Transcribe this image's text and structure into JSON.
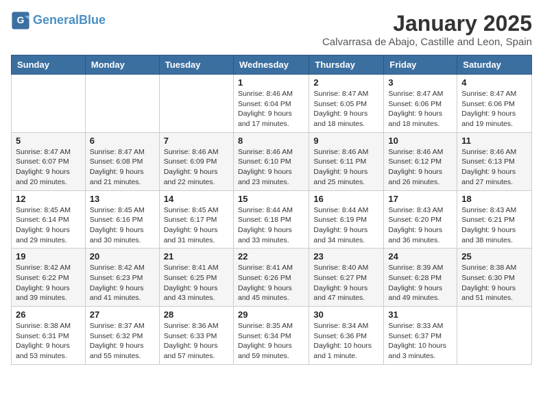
{
  "logo": {
    "line1": "General",
    "line2": "Blue"
  },
  "title": "January 2025",
  "subtitle": "Calvarrasa de Abajo, Castille and Leon, Spain",
  "days_of_week": [
    "Sunday",
    "Monday",
    "Tuesday",
    "Wednesday",
    "Thursday",
    "Friday",
    "Saturday"
  ],
  "weeks": [
    [
      {
        "day": "",
        "info": ""
      },
      {
        "day": "",
        "info": ""
      },
      {
        "day": "",
        "info": ""
      },
      {
        "day": "1",
        "info": "Sunrise: 8:46 AM\nSunset: 6:04 PM\nDaylight: 9 hours and 17 minutes."
      },
      {
        "day": "2",
        "info": "Sunrise: 8:47 AM\nSunset: 6:05 PM\nDaylight: 9 hours and 18 minutes."
      },
      {
        "day": "3",
        "info": "Sunrise: 8:47 AM\nSunset: 6:06 PM\nDaylight: 9 hours and 18 minutes."
      },
      {
        "day": "4",
        "info": "Sunrise: 8:47 AM\nSunset: 6:06 PM\nDaylight: 9 hours and 19 minutes."
      }
    ],
    [
      {
        "day": "5",
        "info": "Sunrise: 8:47 AM\nSunset: 6:07 PM\nDaylight: 9 hours and 20 minutes."
      },
      {
        "day": "6",
        "info": "Sunrise: 8:47 AM\nSunset: 6:08 PM\nDaylight: 9 hours and 21 minutes."
      },
      {
        "day": "7",
        "info": "Sunrise: 8:46 AM\nSunset: 6:09 PM\nDaylight: 9 hours and 22 minutes."
      },
      {
        "day": "8",
        "info": "Sunrise: 8:46 AM\nSunset: 6:10 PM\nDaylight: 9 hours and 23 minutes."
      },
      {
        "day": "9",
        "info": "Sunrise: 8:46 AM\nSunset: 6:11 PM\nDaylight: 9 hours and 25 minutes."
      },
      {
        "day": "10",
        "info": "Sunrise: 8:46 AM\nSunset: 6:12 PM\nDaylight: 9 hours and 26 minutes."
      },
      {
        "day": "11",
        "info": "Sunrise: 8:46 AM\nSunset: 6:13 PM\nDaylight: 9 hours and 27 minutes."
      }
    ],
    [
      {
        "day": "12",
        "info": "Sunrise: 8:45 AM\nSunset: 6:14 PM\nDaylight: 9 hours and 29 minutes."
      },
      {
        "day": "13",
        "info": "Sunrise: 8:45 AM\nSunset: 6:16 PM\nDaylight: 9 hours and 30 minutes."
      },
      {
        "day": "14",
        "info": "Sunrise: 8:45 AM\nSunset: 6:17 PM\nDaylight: 9 hours and 31 minutes."
      },
      {
        "day": "15",
        "info": "Sunrise: 8:44 AM\nSunset: 6:18 PM\nDaylight: 9 hours and 33 minutes."
      },
      {
        "day": "16",
        "info": "Sunrise: 8:44 AM\nSunset: 6:19 PM\nDaylight: 9 hours and 34 minutes."
      },
      {
        "day": "17",
        "info": "Sunrise: 8:43 AM\nSunset: 6:20 PM\nDaylight: 9 hours and 36 minutes."
      },
      {
        "day": "18",
        "info": "Sunrise: 8:43 AM\nSunset: 6:21 PM\nDaylight: 9 hours and 38 minutes."
      }
    ],
    [
      {
        "day": "19",
        "info": "Sunrise: 8:42 AM\nSunset: 6:22 PM\nDaylight: 9 hours and 39 minutes."
      },
      {
        "day": "20",
        "info": "Sunrise: 8:42 AM\nSunset: 6:23 PM\nDaylight: 9 hours and 41 minutes."
      },
      {
        "day": "21",
        "info": "Sunrise: 8:41 AM\nSunset: 6:25 PM\nDaylight: 9 hours and 43 minutes."
      },
      {
        "day": "22",
        "info": "Sunrise: 8:41 AM\nSunset: 6:26 PM\nDaylight: 9 hours and 45 minutes."
      },
      {
        "day": "23",
        "info": "Sunrise: 8:40 AM\nSunset: 6:27 PM\nDaylight: 9 hours and 47 minutes."
      },
      {
        "day": "24",
        "info": "Sunrise: 8:39 AM\nSunset: 6:28 PM\nDaylight: 9 hours and 49 minutes."
      },
      {
        "day": "25",
        "info": "Sunrise: 8:38 AM\nSunset: 6:30 PM\nDaylight: 9 hours and 51 minutes."
      }
    ],
    [
      {
        "day": "26",
        "info": "Sunrise: 8:38 AM\nSunset: 6:31 PM\nDaylight: 9 hours and 53 minutes."
      },
      {
        "day": "27",
        "info": "Sunrise: 8:37 AM\nSunset: 6:32 PM\nDaylight: 9 hours and 55 minutes."
      },
      {
        "day": "28",
        "info": "Sunrise: 8:36 AM\nSunset: 6:33 PM\nDaylight: 9 hours and 57 minutes."
      },
      {
        "day": "29",
        "info": "Sunrise: 8:35 AM\nSunset: 6:34 PM\nDaylight: 9 hours and 59 minutes."
      },
      {
        "day": "30",
        "info": "Sunrise: 8:34 AM\nSunset: 6:36 PM\nDaylight: 10 hours and 1 minute."
      },
      {
        "day": "31",
        "info": "Sunrise: 8:33 AM\nSunset: 6:37 PM\nDaylight: 10 hours and 3 minutes."
      },
      {
        "day": "",
        "info": ""
      }
    ]
  ]
}
